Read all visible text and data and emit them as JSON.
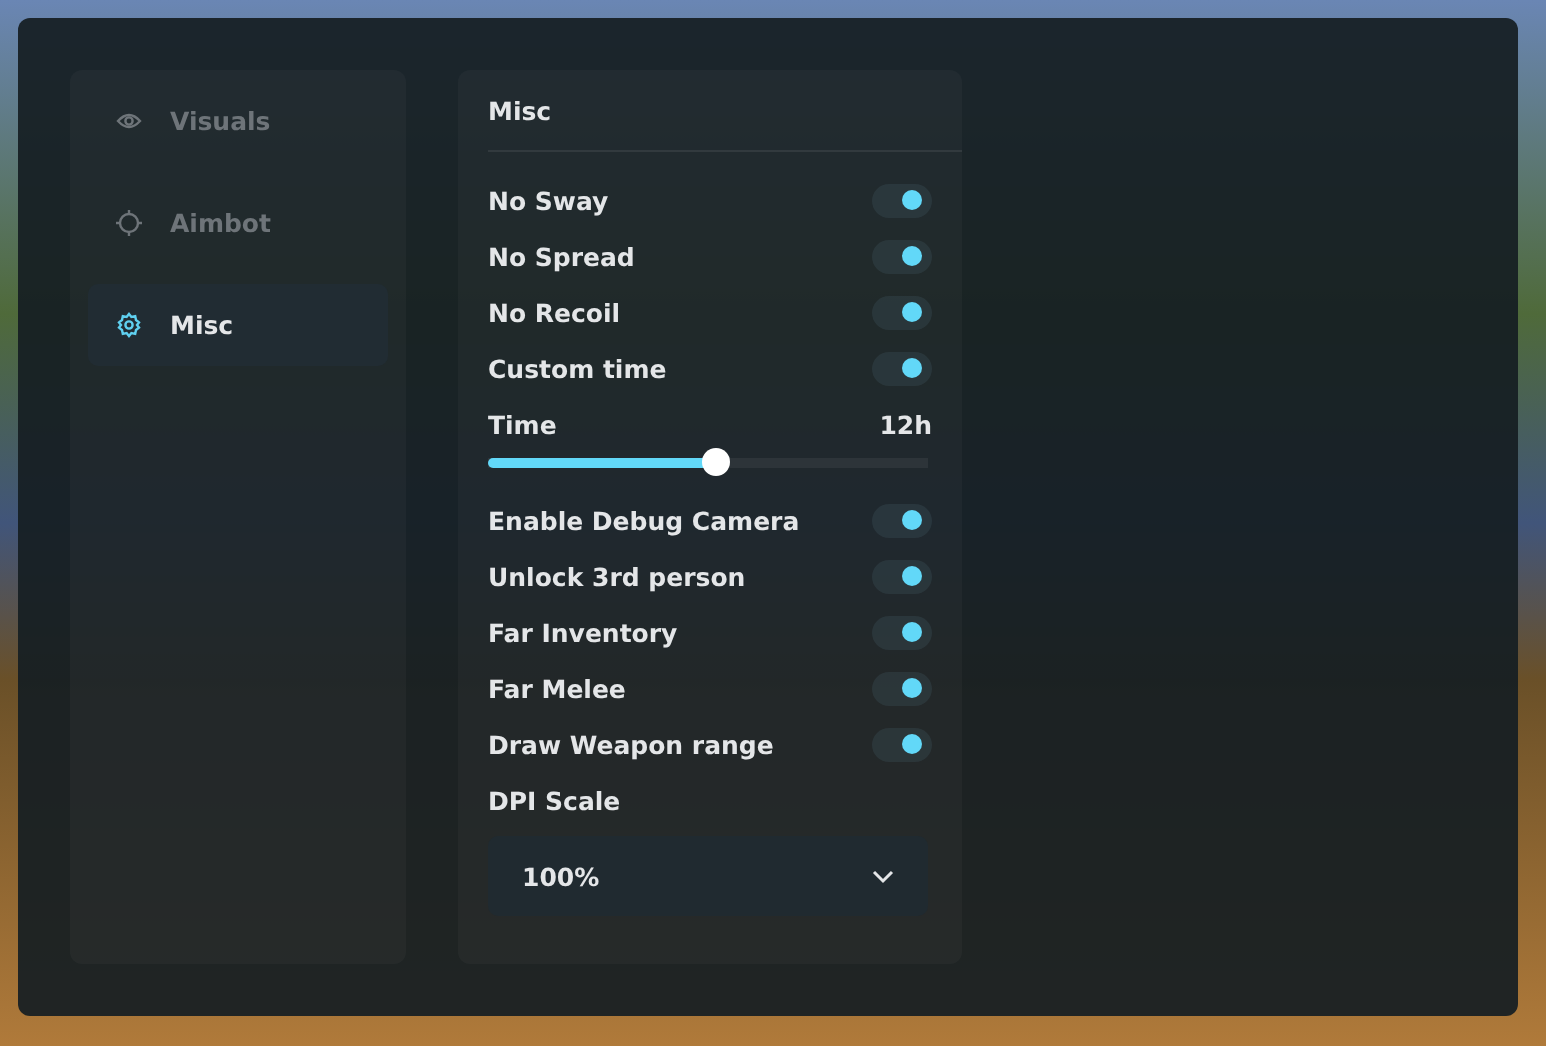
{
  "sidebar": {
    "items": [
      {
        "label": "Visuals",
        "selected": false
      },
      {
        "label": "Aimbot",
        "selected": false
      },
      {
        "label": "Misc",
        "selected": true
      }
    ]
  },
  "panel": {
    "title": "Misc",
    "items": [
      {
        "kind": "toggle",
        "label": "No Sway",
        "on": true
      },
      {
        "kind": "toggle",
        "label": "No Spread",
        "on": true
      },
      {
        "kind": "toggle",
        "label": "No Recoil",
        "on": true
      },
      {
        "kind": "toggle",
        "label": "Custom time",
        "on": true
      },
      {
        "kind": "slider",
        "label": "Time",
        "reading": "12h",
        "level": 0.52
      },
      {
        "kind": "toggle",
        "label": "Enable Debug Camera",
        "on": true
      },
      {
        "kind": "toggle",
        "label": "Unlock 3rd person",
        "on": true
      },
      {
        "kind": "toggle",
        "label": "Far Inventory",
        "on": true
      },
      {
        "kind": "toggle",
        "label": "Far Melee",
        "on": true
      },
      {
        "kind": "toggle",
        "label": "Draw Weapon range",
        "on": true
      },
      {
        "kind": "dropdown",
        "label": "DPI Scale",
        "value": "100%"
      }
    ]
  }
}
